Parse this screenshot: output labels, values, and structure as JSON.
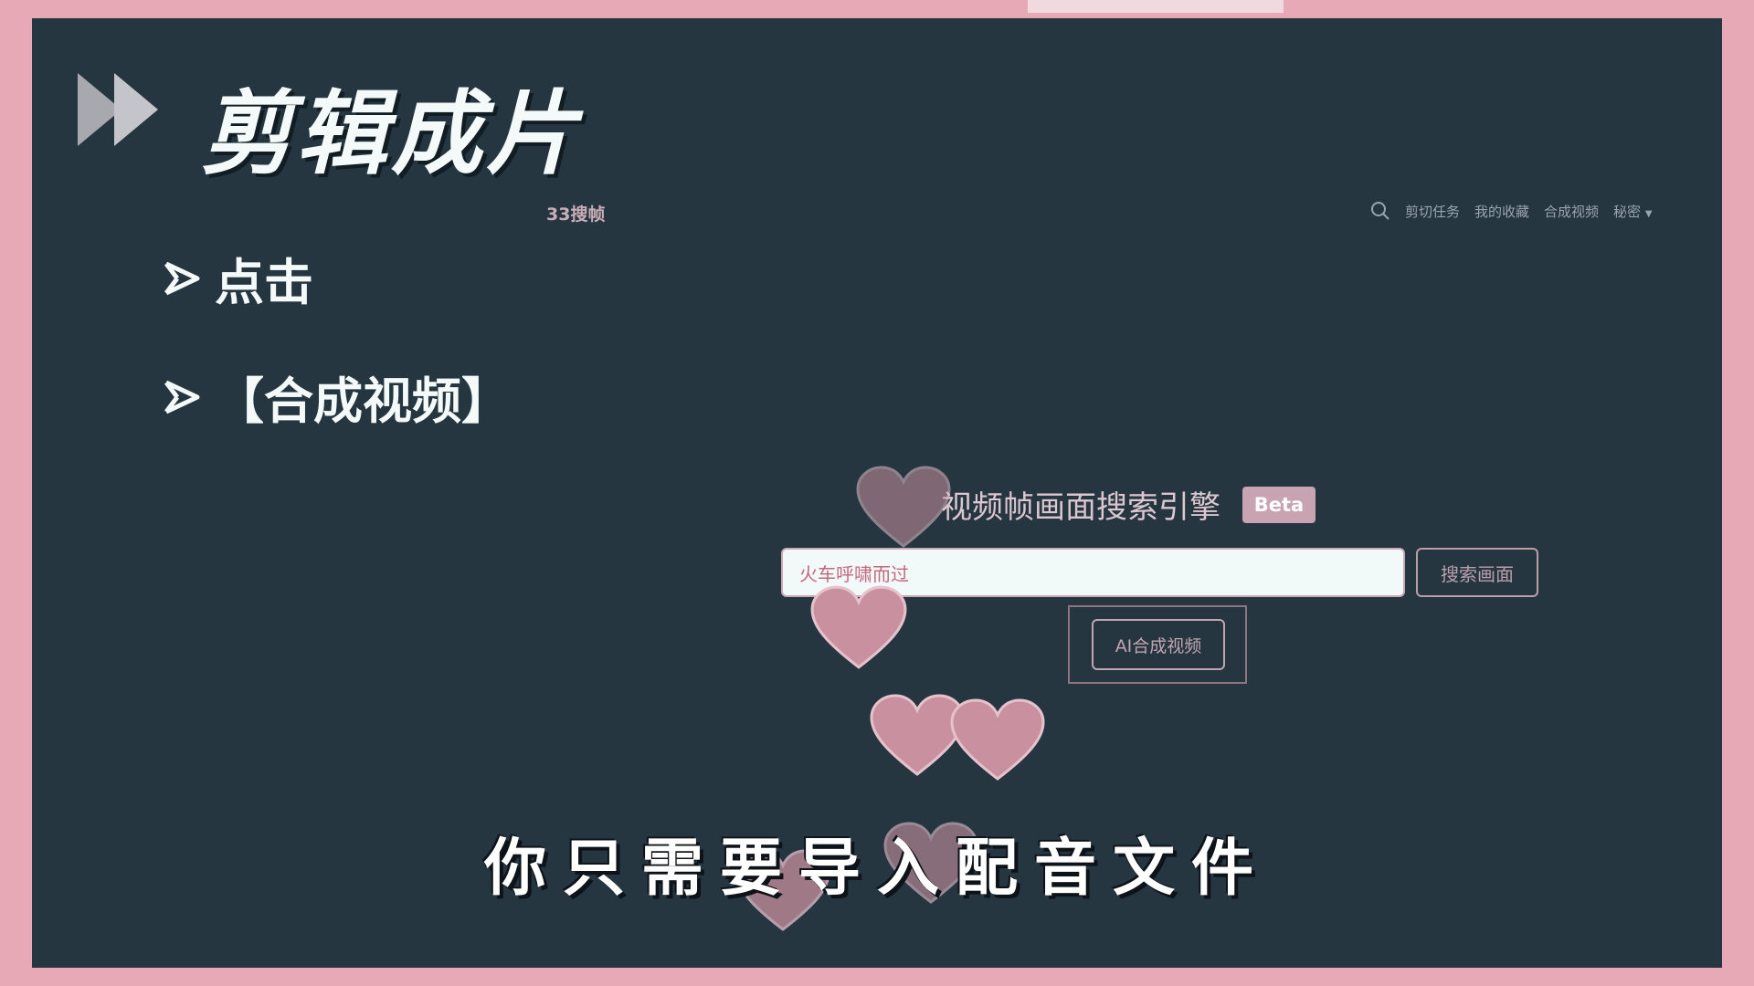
{
  "slide": {
    "title": "剪辑成片",
    "steps": [
      "点击",
      "【合成视频】"
    ],
    "subtitle": "你只需要导入配音文件"
  },
  "screenshot": {
    "logo": "33搜帧",
    "nav": [
      "剪切任务",
      "我的收藏",
      "合成视频",
      "秘密"
    ],
    "hero": {
      "title": "视频帧画面搜索引擎",
      "badge": "Beta"
    },
    "search": {
      "value": "火车呼啸而过",
      "button_label": "搜索画面"
    },
    "ai_button_label": "AI合成视频"
  },
  "icons": [
    "fast-forward-icon",
    "arrow-bullet-icon",
    "search-icon",
    "chevron-down-icon",
    "heart-icon"
  ],
  "colors": {
    "frame_pink": "#E8A9B6",
    "background": "#253641",
    "accent_pink": "#C8A4B2",
    "title_text": "#F4FAF9"
  }
}
